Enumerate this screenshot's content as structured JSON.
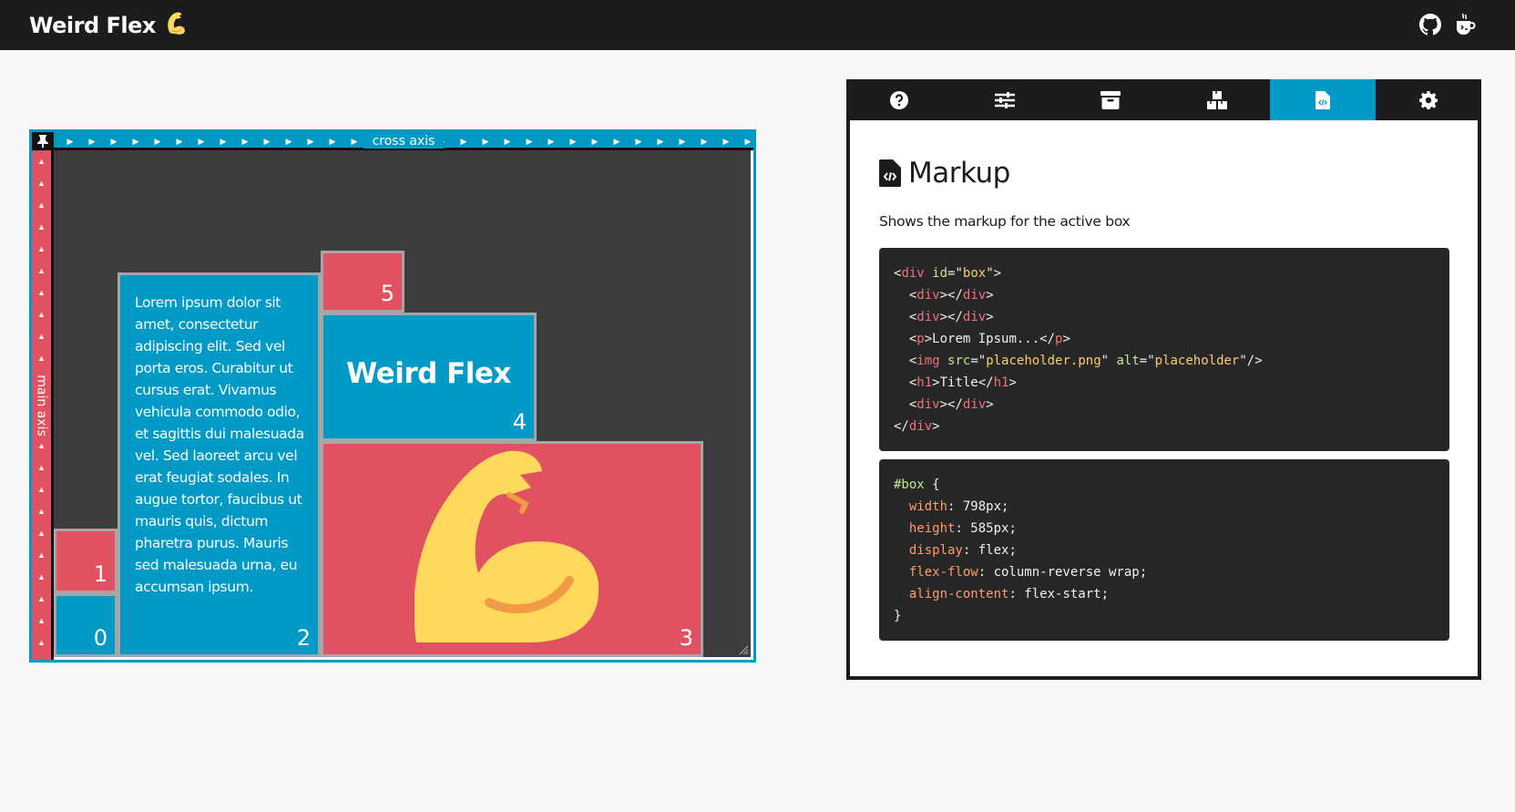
{
  "header": {
    "title": "Weird Flex",
    "emoji": "💪",
    "icons": [
      "github-icon",
      "coffee-icon"
    ]
  },
  "playground": {
    "cross_axis_label": "cross axis",
    "main_axis_label": "main axis",
    "pin_icon": "pin-icon",
    "boxes": [
      {
        "index": "0",
        "color": "blue"
      },
      {
        "index": "1",
        "color": "red"
      },
      {
        "index": "2",
        "color": "blue",
        "text": "Lorem ipsum dolor sit amet, consectetur adipiscing elit. Sed vel porta eros. Curabitur ut cursus erat. Vivamus vehicula commodo odio, et sagittis dui malesuada vel. Sed laoreet arcu vel erat feugiat sodales. In augue tortor, faucibus ut mauris quis, dictum pharetra purus. Mauris sed malesuada urna, eu accumsan ipsum."
      },
      {
        "index": "3",
        "color": "red",
        "image": "bicep-icon"
      },
      {
        "index": "4",
        "color": "blue",
        "title": "Weird Flex"
      },
      {
        "index": "5",
        "color": "red"
      }
    ]
  },
  "panel": {
    "tabs": [
      {
        "icon": "help-icon",
        "active": false
      },
      {
        "icon": "sliders-icon",
        "active": false
      },
      {
        "icon": "archive-icon",
        "active": false
      },
      {
        "icon": "boxes-icon",
        "active": false
      },
      {
        "icon": "code-file-icon",
        "active": true
      },
      {
        "icon": "gear-icon",
        "active": false
      }
    ],
    "section_title": "Markup",
    "description": "Shows the markup for the active box",
    "html_code": {
      "line1_open": "<",
      "line1_tag": "div",
      "line1_attr": "id",
      "line1_eq": "=\"",
      "line1_val": "box",
      "line1_close": "\">",
      "lines": [
        {
          "tag": "div",
          "inner": "",
          "close_tag": "div"
        },
        {
          "tag": "div",
          "inner": "",
          "close_tag": "div"
        },
        {
          "tag": "p",
          "inner": "Lorem Ipsum...",
          "close_tag": "p"
        },
        {
          "img": true,
          "src": "placeholder.png",
          "alt": "placeholder"
        },
        {
          "tag": "h1",
          "inner": "Title",
          "close_tag": "h1"
        },
        {
          "tag": "div",
          "inner": "",
          "close_tag": "div"
        }
      ],
      "end_tag": "div"
    },
    "css_code": {
      "selector": "#box",
      "rules": [
        {
          "prop": "width",
          "value": "798px;"
        },
        {
          "prop": "height",
          "value": "585px;"
        },
        {
          "prop": "display",
          "value": "flex;"
        },
        {
          "prop": "flex-flow",
          "value": "column-reverse wrap;"
        },
        {
          "prop": "align-content",
          "value": "flex-start;"
        }
      ]
    }
  },
  "colors": {
    "header_bg": "#1c1c1c",
    "blue": "#0199c6",
    "red": "#e05261",
    "canvas": "#3d3d3d",
    "bicep_yellow": "#ffd95c",
    "bicep_orange": "#f09b45"
  }
}
